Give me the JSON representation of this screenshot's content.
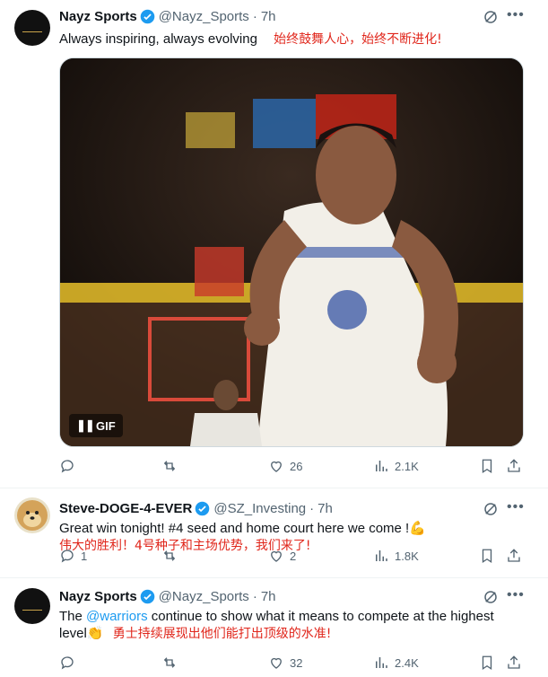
{
  "tweets": [
    {
      "name": "Nayz Sports",
      "handle": "@Nayz_Sports",
      "time": "7h",
      "text_en": "Always inspiring, always evolving",
      "text_cn": "始终鼓舞人心，始终不断进化!",
      "media": {
        "badge": "GIF"
      },
      "stats": {
        "replies": "",
        "reposts": "",
        "likes": "26",
        "views": "2.1K"
      }
    },
    {
      "name": "Steve-DOGE-4-EVER",
      "handle": "@SZ_Investing",
      "time": "7h",
      "text_en": "Great win tonight!  #4 seed and home court here we come !",
      "text_emoji": "💪",
      "text_cn": "伟大的胜利！4号种子和主场优势，我们来了!",
      "stats": {
        "replies": "1",
        "reposts": "",
        "likes": "2",
        "views": "1.8K"
      }
    },
    {
      "name": "Nayz Sports",
      "handle": "@Nayz_Sports",
      "time": "7h",
      "text_pre": "The ",
      "mention": "@warriors",
      "text_post": " continue to show what it means to compete at the highest",
      "text_line2": "level",
      "text_emoji": "👏",
      "text_cn": "勇士持续展现出他们能打出顶级的水准!",
      "stats": {
        "replies": "",
        "reposts": "",
        "likes": "32",
        "views": "2.4K"
      }
    }
  ],
  "colors": {
    "accent": "#1d9bf0",
    "cn_text": "#e0261b",
    "muted": "#536471"
  }
}
